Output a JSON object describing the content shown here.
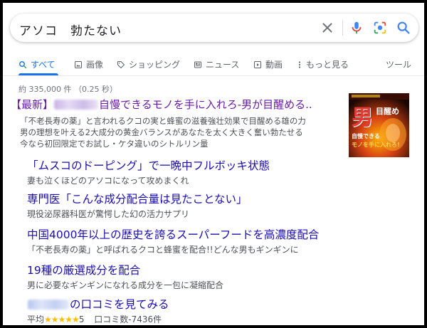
{
  "search": {
    "query": "アソコ　勃たない"
  },
  "tabs": [
    {
      "label": "すべて",
      "icon": "search-icon",
      "active": true
    },
    {
      "label": "画像",
      "icon": "image-icon"
    },
    {
      "label": "ショッピング",
      "icon": "tag-icon"
    },
    {
      "label": "ニュース",
      "icon": "newspaper-icon"
    },
    {
      "label": "動画",
      "icon": "play-icon"
    },
    {
      "label": "もっと見る",
      "icon": "more-vert-icon"
    }
  ],
  "tools_label": "ツール",
  "stats": "約 335,000 件 （0.25 秒）",
  "result": {
    "title_prefix": "【最新】",
    "title_main": "自慢できるモノを手に入れろ-男が目醒める..",
    "desc": [
      "「不老長寿の薬」と言われるクコの実と蜂蜜の滋養強壮効果で目醒める雄の力",
      "男の理想を叶える2大成分の黄金バランスがあなたを太く大きく奮い勃たせる",
      "今なら初回限定でお試し・ケタ違いのシトルリン量"
    ],
    "thumbnail": {
      "big_text": "男",
      "side_text": "目醒め",
      "line1": "自慢できる",
      "line2": "モノを手に入れろ!"
    }
  },
  "sitelinks": [
    {
      "title": "「ムスコのドーピング」で一晩中フルボッキ状態",
      "desc": "妻も泣くほどのアソコになって攻めまくれ"
    },
    {
      "title": "専門医「こんな成分配合量は見たことない」",
      "desc": "現役泌尿器科医が驚愕した幻の活力サプリ"
    },
    {
      "title": "中国4000年以上の歴史を誇るスーパーフードを高濃度配合",
      "desc": "「不老長寿の薬」と呼ばれるクコと蜂蜜を配合!!どんな男もギンギンに"
    },
    {
      "title": "19種の厳選成分を配合",
      "desc": "男に必要なギンギンになれる成分を一包に凝縮配合"
    },
    {
      "title": "の口コミを見てみる",
      "desc": ""
    }
  ],
  "rating": {
    "label": "平均",
    "stars": "★★★★★",
    "score": "5",
    "reviews": "口コミ数-7436件"
  },
  "colors": {
    "link": "#1a0dab",
    "visited": "#681da8",
    "accent": "#1a73e8",
    "text": "#4d5156",
    "star": "#fbbc04"
  }
}
